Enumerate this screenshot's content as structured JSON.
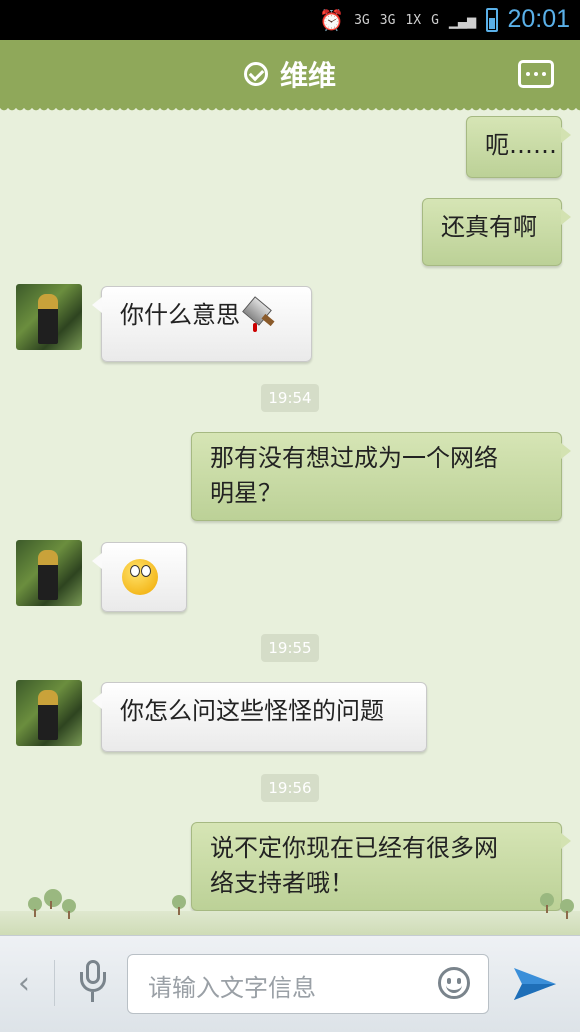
{
  "statusbar": {
    "signal_labels": [
      "3G",
      "3G",
      "1X",
      "G"
    ],
    "time": "20:01"
  },
  "header": {
    "title": "维维"
  },
  "messages": [
    {
      "dir": "out",
      "text": "呃……"
    },
    {
      "dir": "out",
      "text": "还真有啊"
    },
    {
      "dir": "in",
      "text": "你什么意思",
      "icon": "cleaver-icon"
    },
    {
      "type": "time",
      "text": "19:54"
    },
    {
      "dir": "out",
      "text_line1": "那有没有想过成为一个网络",
      "text_line2": "明星？"
    },
    {
      "dir": "in",
      "icon": "rolling-eyes-emoji"
    },
    {
      "type": "time",
      "text": "19:55"
    },
    {
      "dir": "in",
      "text": "你怎么问这些怪怪的问题"
    },
    {
      "type": "time",
      "text": "19:56"
    },
    {
      "dir": "out",
      "text_line1": "说不定你现在已经有很多网",
      "text_line2": "络支持者哦！"
    }
  ],
  "composer": {
    "placeholder": "请输入文字信息"
  },
  "colors": {
    "header": "#8fa85a",
    "out_bubble": "#c8dba4",
    "in_bubble": "#ffffff",
    "time_accent": "#5ab0e8"
  }
}
